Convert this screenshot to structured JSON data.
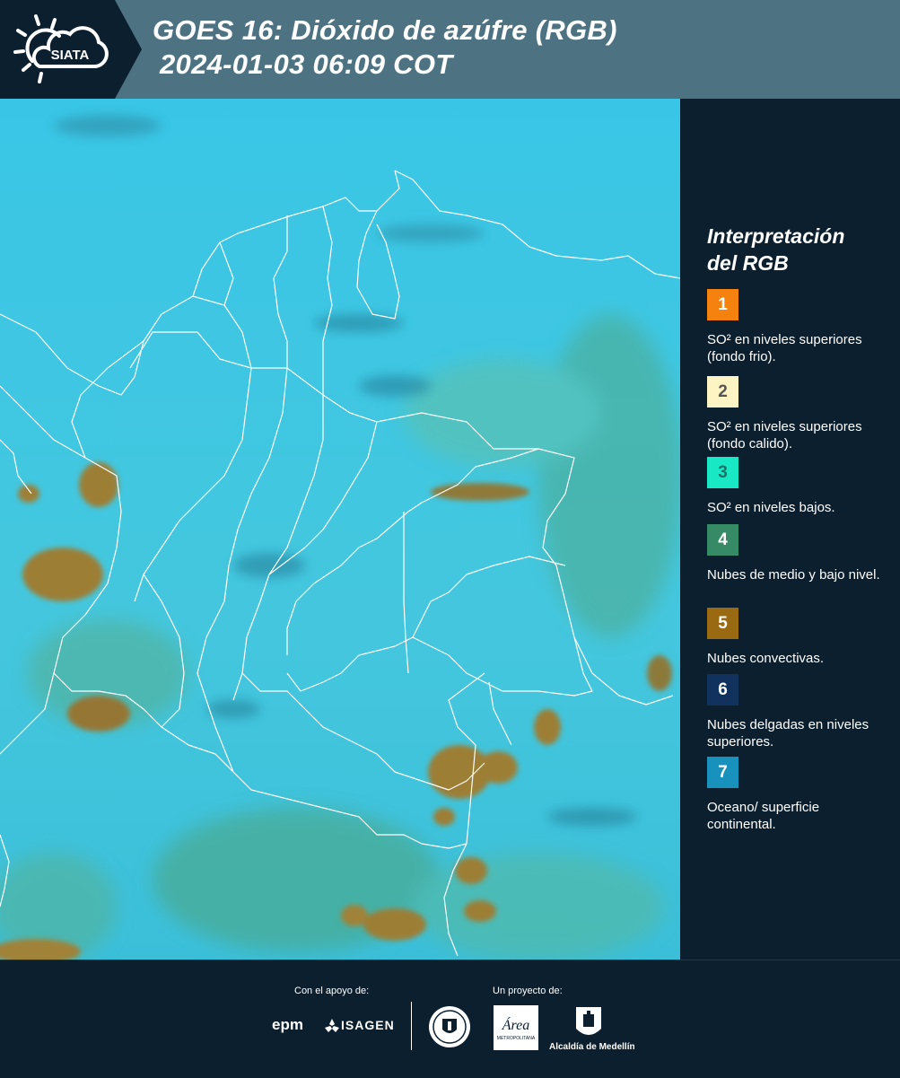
{
  "header": {
    "logo_text": "SIATA",
    "title_line1": "GOES 16: Dióxido de azúfre (RGB)",
    "title_line2": "2024-01-03 06:09 COT"
  },
  "legend": {
    "title_line1": "Interpretación",
    "title_line2": "del RGB",
    "items": [
      {
        "number": "1",
        "color": "#f5820f",
        "text_color": "#ffffff",
        "label": "SO² en niveles superiores (fondo frio)."
      },
      {
        "number": "2",
        "color": "#fdf4c4",
        "text_color": "#555555",
        "label": "SO² en niveles superiores (fondo calido)."
      },
      {
        "number": "3",
        "color": "#19e8c5",
        "text_color": "#1f6f66",
        "label": "SO² en niveles bajos."
      },
      {
        "number": "4",
        "color": "#378a66",
        "text_color": "#ffffff",
        "label": "Nubes de medio y bajo nivel."
      },
      {
        "number": "5",
        "color": "#996a12",
        "text_color": "#ffffff",
        "label": "Nubes convectivas."
      },
      {
        "number": "6",
        "color": "#10325d",
        "text_color": "#ffffff",
        "label": "Nubes delgadas en niveles superiores."
      },
      {
        "number": "7",
        "color": "#1991bd",
        "text_color": "#ffffff",
        "label": "Oceano/ superficie continental."
      }
    ]
  },
  "footer": {
    "support_caption": "Con el apoyo de:",
    "project_caption": "Un proyecto de:",
    "epm_text": "epm",
    "isagen_text": "ISAGEN",
    "area_text": "Área",
    "area_subtext": "METROPOLITANA",
    "alcaldia_text": "Alcaldía de Medellín"
  },
  "colors": {
    "sky": "#38c4e3",
    "convective": "#9a7a2e",
    "low_cloud": "#3e9a6a",
    "thin_cloud": "#1d5a7a",
    "border": "#ffffff"
  }
}
